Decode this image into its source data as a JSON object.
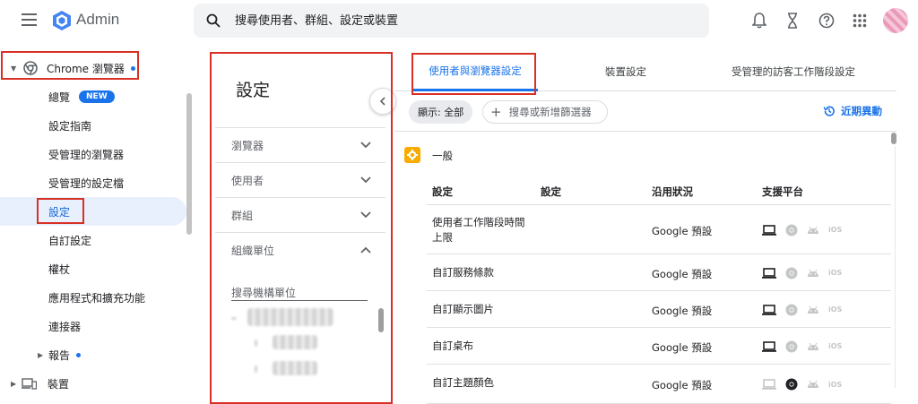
{
  "app": {
    "title": "Admin"
  },
  "search": {
    "placeholder": "搜尋使用者、群組、設定或裝置"
  },
  "header_icons": [
    "bell-icon",
    "hourglass-icon",
    "help-icon",
    "apps-grid-icon",
    "avatar"
  ],
  "sidebar": {
    "chrome_label": "Chrome 瀏覽器",
    "items": [
      {
        "label": "總覽",
        "badge": "NEW"
      },
      {
        "label": "設定指南"
      },
      {
        "label": "受管理的瀏覽器"
      },
      {
        "label": "受管理的設定檔"
      },
      {
        "label": "設定",
        "active": true
      },
      {
        "label": "自訂設定"
      },
      {
        "label": "權杖"
      },
      {
        "label": "應用程式和擴充功能"
      },
      {
        "label": "連接器"
      },
      {
        "label": "報告"
      }
    ],
    "devices_label": "裝置"
  },
  "panel": {
    "title": "設定",
    "sections": [
      "瀏覽器",
      "使用者",
      "群組",
      "組織單位"
    ],
    "org_search_placeholder": "搜尋機構單位"
  },
  "main": {
    "tabs": [
      "使用者與瀏覽器設定",
      "裝置設定",
      "受管理的訪客工作階段設定"
    ],
    "filter_chip": "顯示: 全部",
    "filter_search": "搜尋或新增篩選器",
    "recent_changes": "近期異動",
    "section_title": "一般",
    "columns": [
      "設定",
      "設定",
      "沿用狀況",
      "支援平台"
    ],
    "rows": [
      {
        "name": "使用者工作階段時間上限",
        "status": "Google 預設",
        "chrome_colored": false
      },
      {
        "name": "自訂服務條款",
        "status": "Google 預設",
        "chrome_colored": false
      },
      {
        "name": "自訂顯示圖片",
        "status": "Google 預設",
        "chrome_colored": false
      },
      {
        "name": "自訂桌布",
        "status": "Google 預設",
        "chrome_colored": false
      },
      {
        "name": "自訂主題顏色",
        "status": "Google 預設",
        "chrome_colored": true
      }
    ],
    "platform_ios_label": "iOS"
  },
  "colors": {
    "accent": "#1a73e8",
    "highlight_box": "#d93025",
    "active_bg": "#e8f0fe"
  }
}
